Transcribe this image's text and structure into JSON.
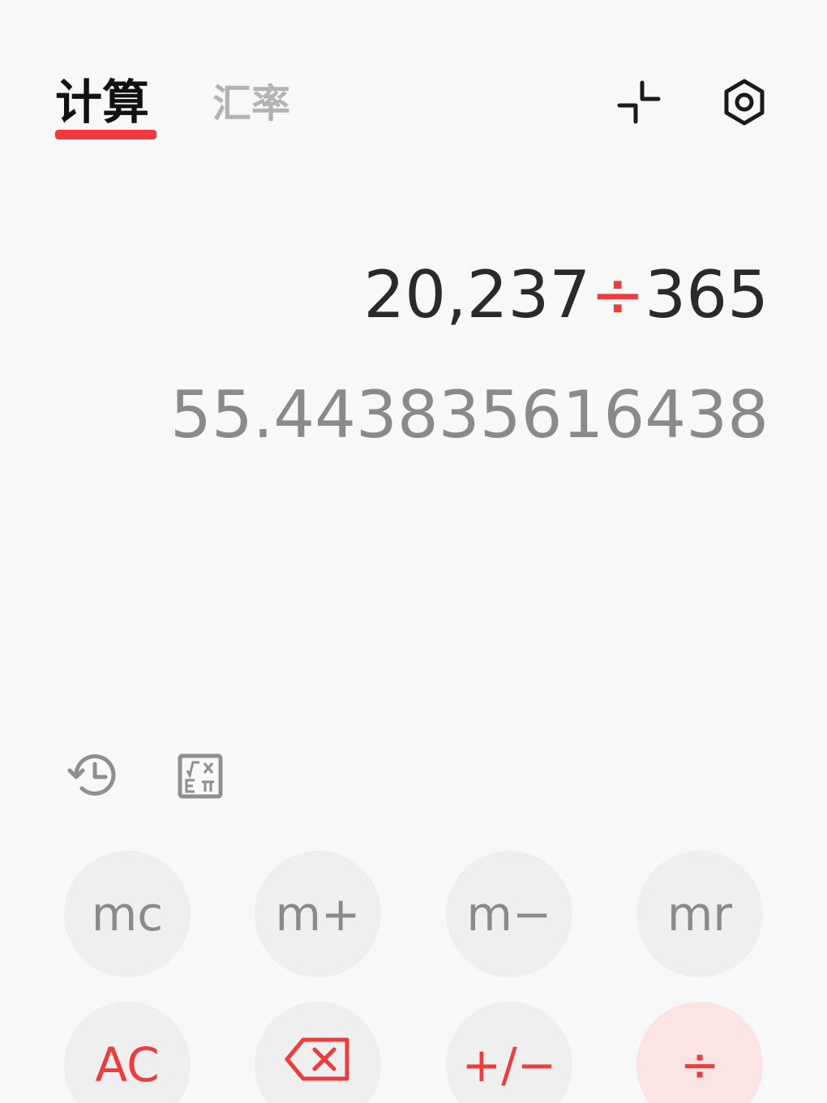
{
  "tabs": [
    {
      "label": "计算",
      "active": true
    },
    {
      "label": "汇率",
      "active": false
    }
  ],
  "top_icons": {
    "collapse": "collapse-icon",
    "settings": "settings-icon"
  },
  "display": {
    "expression_left": "20,237",
    "expression_operator": "÷",
    "expression_right": "365",
    "result": "55.443835616438"
  },
  "tools": {
    "history": "history-icon",
    "scientific": "scientific-mode-icon"
  },
  "keys": {
    "row1": [
      "mc",
      "m+",
      "m−",
      "mr"
    ],
    "row2": [
      "AC",
      "backspace",
      "+/−",
      "÷"
    ]
  },
  "colors": {
    "accent": "#ef3b3b",
    "key_bg": "#efefef",
    "divide_key_bg": "#fbe4e4",
    "background": "#f8f8f8"
  }
}
